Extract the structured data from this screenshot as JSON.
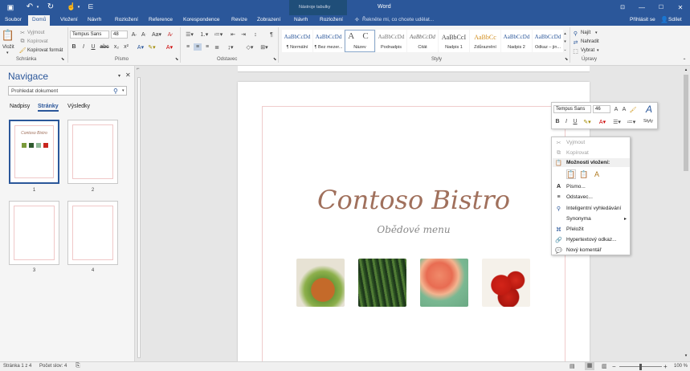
{
  "titlebar": {
    "title": "Word",
    "context_tab_group": "Nástroje tabulky",
    "signin": "Přihlásit se",
    "share": "Sdílet"
  },
  "tabs": [
    "Soubor",
    "Domů",
    "Vložení",
    "Návrh",
    "Rozložení",
    "Reference",
    "Korespondence",
    "Revize",
    "Zobrazení",
    "Návrh",
    "Rozložení"
  ],
  "tellme": "Řekněte mi, co chcete udělat...",
  "ribbon": {
    "clipboard": {
      "paste": "Vložit",
      "cut": "Vyjmout",
      "copy": "Kopírovat",
      "format_painter": "Kopírovat formát",
      "group": "Schránka"
    },
    "font": {
      "name": "Tempus Sans",
      "size": "48",
      "group": "Písmo"
    },
    "paragraph": {
      "group": "Odstavec"
    },
    "styles": {
      "group": "Styly",
      "items": [
        {
          "sample": "AaBbCcDd",
          "name": "¶ Normální"
        },
        {
          "sample": "AaBbCcDd",
          "name": "¶ Bez mezer..."
        },
        {
          "sample": "A C",
          "name": "Název"
        },
        {
          "sample": "AaBbCcDd",
          "name": "Podnadpis"
        },
        {
          "sample": "AaBbCcDd",
          "name": "Citát"
        },
        {
          "sample": "AaBbCcI",
          "name": "Nadpis 1"
        },
        {
          "sample": "AaBbCc",
          "name": "Zdůraznění"
        },
        {
          "sample": "AaBbCcDd",
          "name": "Nadpis 2"
        },
        {
          "sample": "AaBbCcDd",
          "name": "Odkaz – jin..."
        }
      ]
    },
    "editing": {
      "find": "Najít",
      "replace": "Nahradit",
      "select": "Vybrat",
      "group": "Úpravy"
    }
  },
  "navigation": {
    "title": "Navigace",
    "search_placeholder": "Prohledat dokument",
    "tabs": [
      "Nadpisy",
      "Stránky",
      "Výsledky"
    ],
    "pages": [
      "1",
      "2",
      "3",
      "4"
    ],
    "thumb1_title": "Contoso Bistro"
  },
  "document": {
    "title": "Contoso Bistro",
    "subtitle": "Obědové menu"
  },
  "mini_toolbar": {
    "font": "Tempus Sans",
    "size": "46",
    "styles": "Styly"
  },
  "context_menu": {
    "cut": "Vyjmout",
    "copy": "Kopírovat",
    "paste_options": "Možnosti vložení:",
    "font": "Písmo...",
    "paragraph": "Odstavec...",
    "smart_lookup": "Inteligentní vyhledávání",
    "synonyms": "Synonyma",
    "translate": "Přeložit",
    "hyperlink": "Hypertextový odkaz...",
    "new_comment": "Nový komentář"
  },
  "statusbar": {
    "page": "Stránka 1 z 4",
    "words": "Počet slov: 4",
    "zoom": "100 %"
  },
  "colors": {
    "brand": "#2b579a",
    "title": "#a0705c"
  }
}
